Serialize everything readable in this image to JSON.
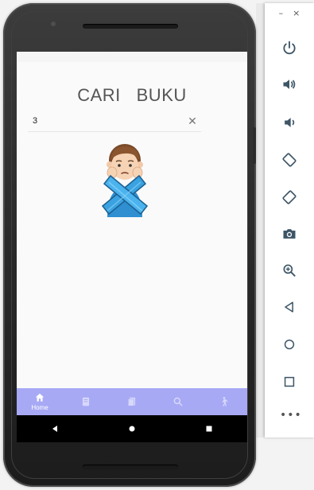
{
  "app": {
    "title": "CARI   BUKU"
  },
  "search": {
    "value": "3",
    "clear_label": "✕"
  },
  "illustration": {
    "icon": "no-results-person-crossed-arms-icon"
  },
  "bottom_nav": {
    "items": [
      {
        "label": "Home",
        "icon": "home-icon",
        "active": true
      },
      {
        "label": "",
        "icon": "book-icon",
        "active": false
      },
      {
        "label": "",
        "icon": "books-icon",
        "active": false
      },
      {
        "label": "",
        "icon": "search-icon",
        "active": false
      },
      {
        "label": "",
        "icon": "person-walking-icon",
        "active": false
      }
    ],
    "color": "#a7a9f5"
  },
  "emulator": {
    "window_minimize": "–",
    "window_close": "×",
    "tools": [
      {
        "icon": "power-icon"
      },
      {
        "icon": "volume-up-icon"
      },
      {
        "icon": "volume-down-icon"
      },
      {
        "icon": "rotate-left-icon"
      },
      {
        "icon": "rotate-right-icon"
      },
      {
        "icon": "camera-icon"
      },
      {
        "icon": "zoom-icon"
      },
      {
        "icon": "back-icon"
      },
      {
        "icon": "home-circle-icon"
      },
      {
        "icon": "overview-icon"
      }
    ],
    "more_label": "•••"
  }
}
